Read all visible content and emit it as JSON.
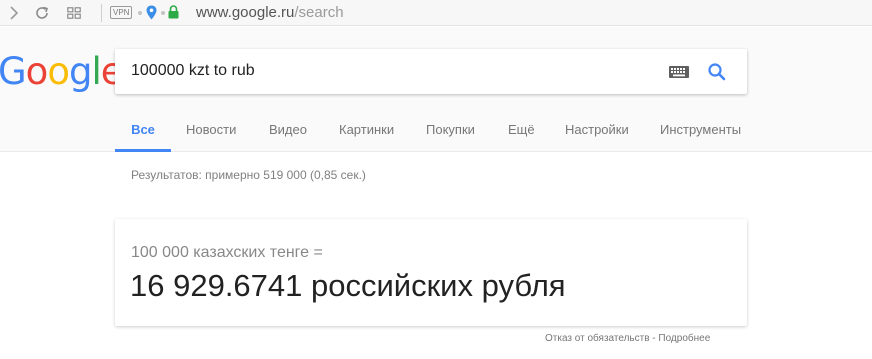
{
  "browser": {
    "vpn_label": "VPN",
    "address_host": "www.google.ru",
    "address_path": "/search"
  },
  "logo": {
    "letters": [
      "G",
      "o",
      "o",
      "g",
      "l",
      "e"
    ],
    "colors": [
      "#4285f4",
      "#ea4335",
      "#fbbc05",
      "#4285f4",
      "#34a853",
      "#ea4335"
    ]
  },
  "search": {
    "query": "100000 kzt to rub"
  },
  "tabs": [
    {
      "label": "Все",
      "active": true
    },
    {
      "label": "Новости",
      "active": false
    },
    {
      "label": "Видео",
      "active": false
    },
    {
      "label": "Картинки",
      "active": false
    },
    {
      "label": "Покупки",
      "active": false
    },
    {
      "label": "Ещё",
      "active": false
    },
    {
      "label": "Настройки",
      "active": false
    },
    {
      "label": "Инструменты",
      "active": false
    }
  ],
  "results": {
    "stats": "Результатов: примерно 519 000 (0,85 сек.)"
  },
  "converter": {
    "from_text": "100 000 казахских тенге =",
    "result_text": "16 929.6741 российских рубля"
  },
  "footer": {
    "disclaimer": "Отказ от обязательств - Подробнее"
  },
  "colors": {
    "accent": "#4285f4",
    "lock_green": "#2cab47",
    "location_blue": "#3b8ee8"
  },
  "icons": [
    "forward-icon",
    "reload-icon",
    "speed-dial-icon",
    "location-icon",
    "lock-icon",
    "keyboard-icon",
    "search-icon"
  ]
}
